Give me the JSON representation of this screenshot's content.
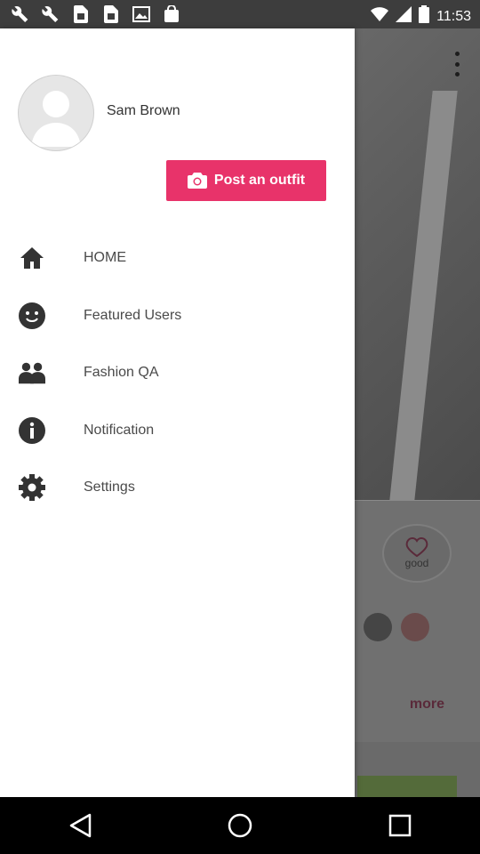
{
  "status_bar": {
    "time": "11:53",
    "icons": [
      "wrench-icon",
      "wrench-icon",
      "sim-icon",
      "sim-icon",
      "image-icon",
      "shopping-bag-icon"
    ]
  },
  "drawer": {
    "user_name": "Sam Brown",
    "post_button_label": "Post an outfit",
    "menu": [
      {
        "label": "HOME",
        "icon": "home-icon"
      },
      {
        "label": "Featured Users",
        "icon": "smiley-icon"
      },
      {
        "label": "Fashion QA",
        "icon": "group-icon"
      },
      {
        "label": "Notification",
        "icon": "info-icon"
      },
      {
        "label": "Settings",
        "icon": "gear-icon"
      }
    ]
  },
  "background": {
    "good_label": "good",
    "more_label": "more"
  },
  "colors": {
    "accent": "#e8336a",
    "drawer_bg": "#ffffff",
    "icon": "#333333"
  }
}
